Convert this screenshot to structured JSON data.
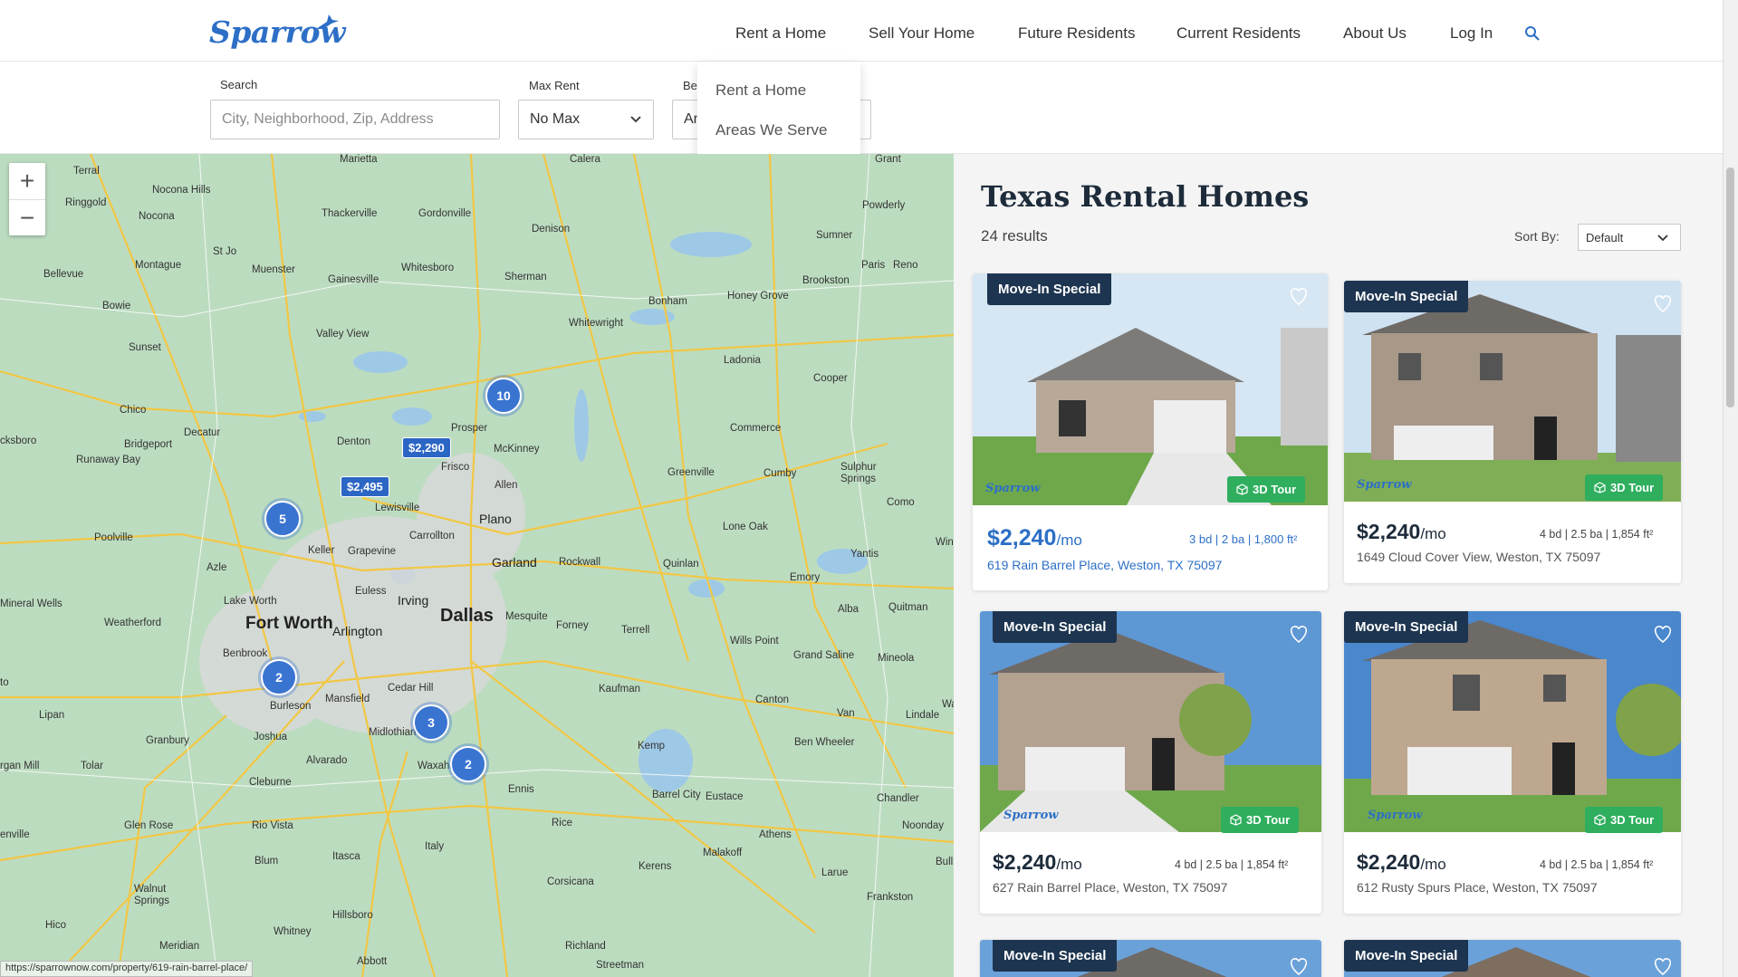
{
  "header": {
    "logo": "Sparrow",
    "nav": [
      "Rent a Home",
      "Sell Your Home",
      "Future Residents",
      "Current Residents",
      "About Us",
      "Log In"
    ]
  },
  "dropdown": {
    "items": [
      "Rent a Home",
      "Areas We Serve"
    ]
  },
  "filters": {
    "search_label": "Search",
    "search_placeholder": "City, Neighborhood, Zip, Address",
    "maxrent_label": "Max Rent",
    "maxrent_value": "No Max",
    "beds_label": "Be",
    "beds_value": "An"
  },
  "map": {
    "cities_big": [
      "Fort Worth",
      "Dallas"
    ],
    "cities_med": [
      "Arlington",
      "Plano",
      "Garland",
      "Irving",
      "McKinney",
      "Frisco",
      "Denton"
    ],
    "cities": [
      "Terral",
      "Nocona Hills",
      "Ringgold",
      "Nocona",
      "Marietta",
      "Calera",
      "Thackerville",
      "Gordonville",
      "Denison",
      "Powderly",
      "Sumner",
      "Bellevue",
      "Montague",
      "St Jo",
      "Muenster",
      "Gainesville",
      "Whitesboro",
      "Sherman",
      "Paris",
      "Reno",
      "Brookston",
      "Bowie",
      "Bonham",
      "Honey Grove",
      "Valley View",
      "Whitewright",
      "Sunset",
      "Ladonia",
      "Cooper",
      "Chico",
      "Bridgeport",
      "Decatur",
      "Prosper",
      "Commerce",
      "cksboro",
      "Runaway Bay",
      "Allen",
      "Greenville",
      "Cumby",
      "Sulphur Springs",
      "Lewisville",
      "Como",
      "Poolville",
      "Keller",
      "Carrollton",
      "Lone Oak",
      "Yantis",
      "Azle",
      "Grapevine",
      "Rockwall",
      "Quinlan",
      "Emory",
      "Euless",
      "Mineral Wells",
      "Lake Worth",
      "Mesquite",
      "Forney",
      "Terrell",
      "Alba",
      "Quitman",
      "Weatherford",
      "Wills Point",
      "Grand Saline",
      "Mineola",
      "Benbrook",
      "Kaufman",
      "Cedar Hill",
      "Mansfield",
      "Burleson",
      "Lipan",
      "Canton",
      "Van",
      "Lindale",
      "Granbury",
      "Joshua",
      "Midlothian",
      "Kemp",
      "Ben Wheeler",
      "rgan Mill",
      "Tolar",
      "Alvarado",
      "Waxahachie",
      "Cleburne",
      "Ennis",
      "Chandler",
      "Barrel City",
      "Eustace",
      "Rio Vista",
      "Glen Rose",
      "Rice",
      "Athens",
      "Noonday",
      "enville",
      "Blum",
      "Itasca",
      "Italy",
      "Malakoff",
      "Bull",
      "Walnut Springs",
      "Corsicana",
      "Kerens",
      "Larue",
      "Frankston",
      "Hico",
      "Hillsboro",
      "Whitney",
      "Meridian",
      "Abbott",
      "Richland",
      "Streetman",
      "Grant",
      "Win",
      "Wa",
      "to"
    ],
    "clusters": [
      "10",
      "5",
      "2",
      "3",
      "2"
    ],
    "price_pins": [
      "$2,290",
      "$2,495"
    ],
    "status_url": "https://sparrownow.com/property/619-rain-barrel-place/"
  },
  "listings": {
    "title": "Texas Rental Homes",
    "results": "24 results",
    "sort_label": "Sort By:",
    "sort_value": "Default",
    "cards": [
      {
        "badge": "Move-In Special",
        "tour": "3D Tour",
        "brand": "Sparrow",
        "price": "$2,240",
        "per": "/mo",
        "specs": "3 bd | 2 ba | 1,800 ft²",
        "address": "619 Rain Barrel Place, Weston, TX 75097"
      },
      {
        "badge": "Move-In Special",
        "tour": "3D Tour",
        "brand": "Sparrow",
        "price": "$2,240",
        "per": "/mo",
        "specs": "4 bd | 2.5 ba | 1,854 ft²",
        "address": "1649 Cloud Cover View, Weston, TX 75097"
      },
      {
        "badge": "Move-In Special",
        "tour": "3D Tour",
        "brand": "Sparrow",
        "price": "$2,240",
        "per": "/mo",
        "specs": "4 bd | 2.5 ba | 1,854 ft²",
        "address": "627 Rain Barrel Place, Weston, TX 75097"
      },
      {
        "badge": "Move-In Special",
        "tour": "3D Tour",
        "brand": "Sparrow",
        "price": "$2,240",
        "per": "/mo",
        "specs": "4 bd | 2.5 ba | 1,854 ft²",
        "address": "612 Rusty Spurs Place, Weston, TX 75097"
      },
      {
        "badge": "Move-In Special"
      },
      {
        "badge": "Move-In Special"
      }
    ]
  },
  "colors": {
    "brand": "#2d6fc6",
    "badge": "#1d3550",
    "tour": "#2fae5e",
    "map": "#bcdcc0",
    "cluster": "#3a74d1"
  }
}
